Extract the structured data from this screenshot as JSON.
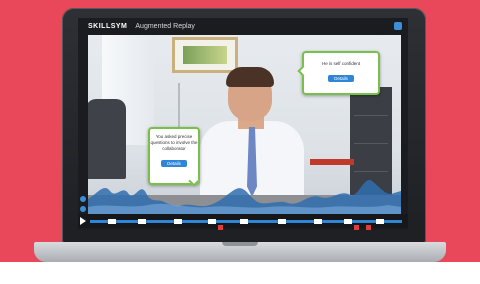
{
  "app": {
    "brand": "SKILLSYM",
    "title": "Augmented Replay"
  },
  "feedback": [
    {
      "message": "He is self confident",
      "button": "Details"
    },
    {
      "message": "You asked precise questions to involve the collaborator",
      "button": "Details"
    }
  ],
  "colors": {
    "background": "#e8485a",
    "accent": "#2f86d6",
    "bubble_border": "#78c04a",
    "marker": "#e23b3b"
  },
  "icons": [
    "play-icon",
    "menu-icon",
    "playhead-icon"
  ]
}
